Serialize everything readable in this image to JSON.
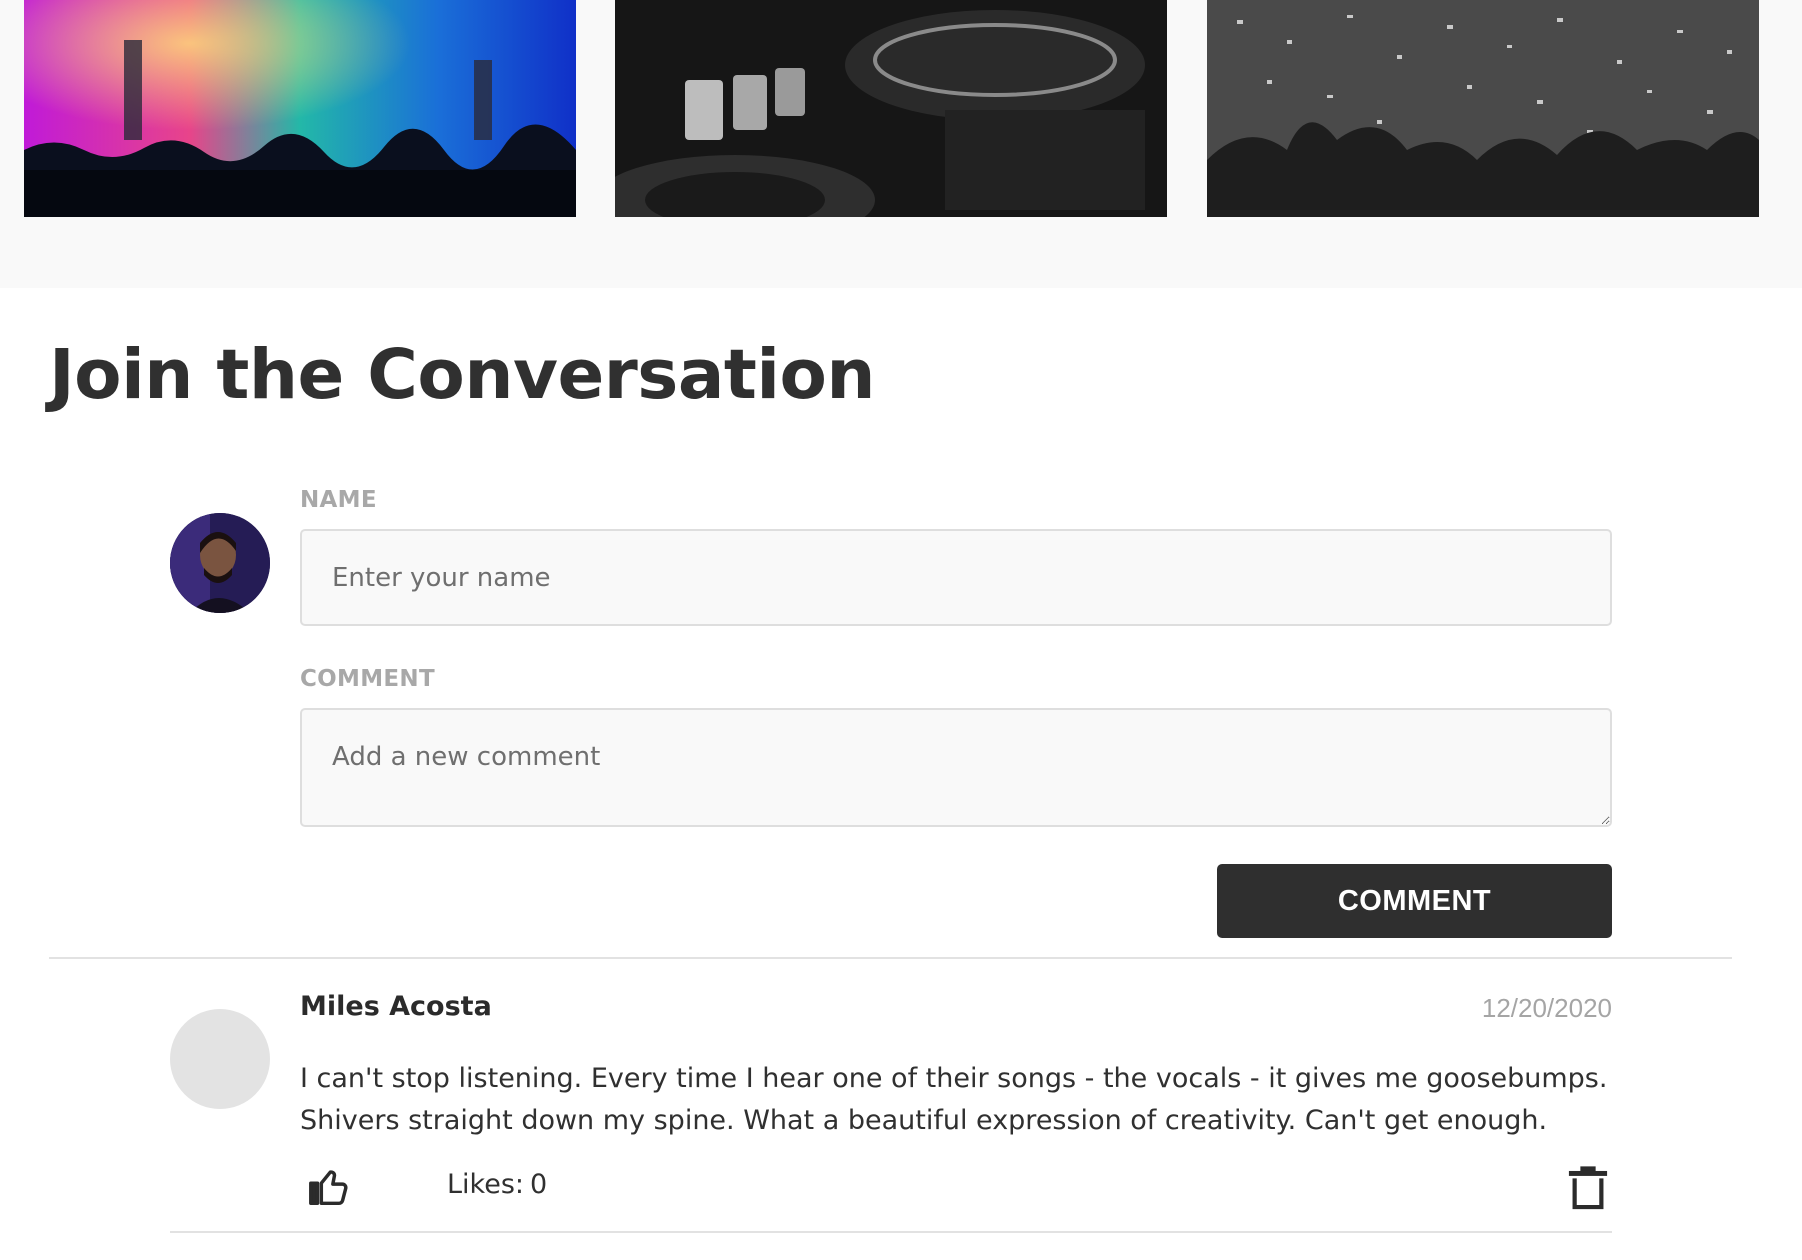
{
  "gallery": {
    "photos": [
      {
        "name": "concert-stage-photo",
        "description": "colorful concert lights"
      },
      {
        "name": "dj-turntable-photo",
        "description": "black and white dj mixer"
      },
      {
        "name": "confetti-crowd-photo",
        "description": "black and white crowd with confetti"
      }
    ]
  },
  "section": {
    "title": "Join the Conversation"
  },
  "form": {
    "name_label": "NAME",
    "name_placeholder": "Enter your name",
    "name_value": "",
    "comment_label": "COMMENT",
    "comment_placeholder": "Add a new comment",
    "comment_value": "",
    "submit_label": "COMMENT"
  },
  "comments": [
    {
      "author": "Miles Acosta",
      "date": "12/20/2020",
      "text": "I can't stop listening. Every time I hear one of their songs - the vocals - it gives me goosebumps. Shivers straight down my spine. What a beautiful expression of creativity. Can't get enough.",
      "likes_label": "Likes:",
      "likes_count": "0",
      "like_icon": "thumbs-up-icon",
      "delete_icon": "trash-icon"
    }
  ],
  "colors": {
    "text": "#303030",
    "button": "#2f2f2f",
    "label": "#a8a8a8",
    "divider": "#e2e2e2",
    "gallery_bg": "#f9f9f9"
  }
}
